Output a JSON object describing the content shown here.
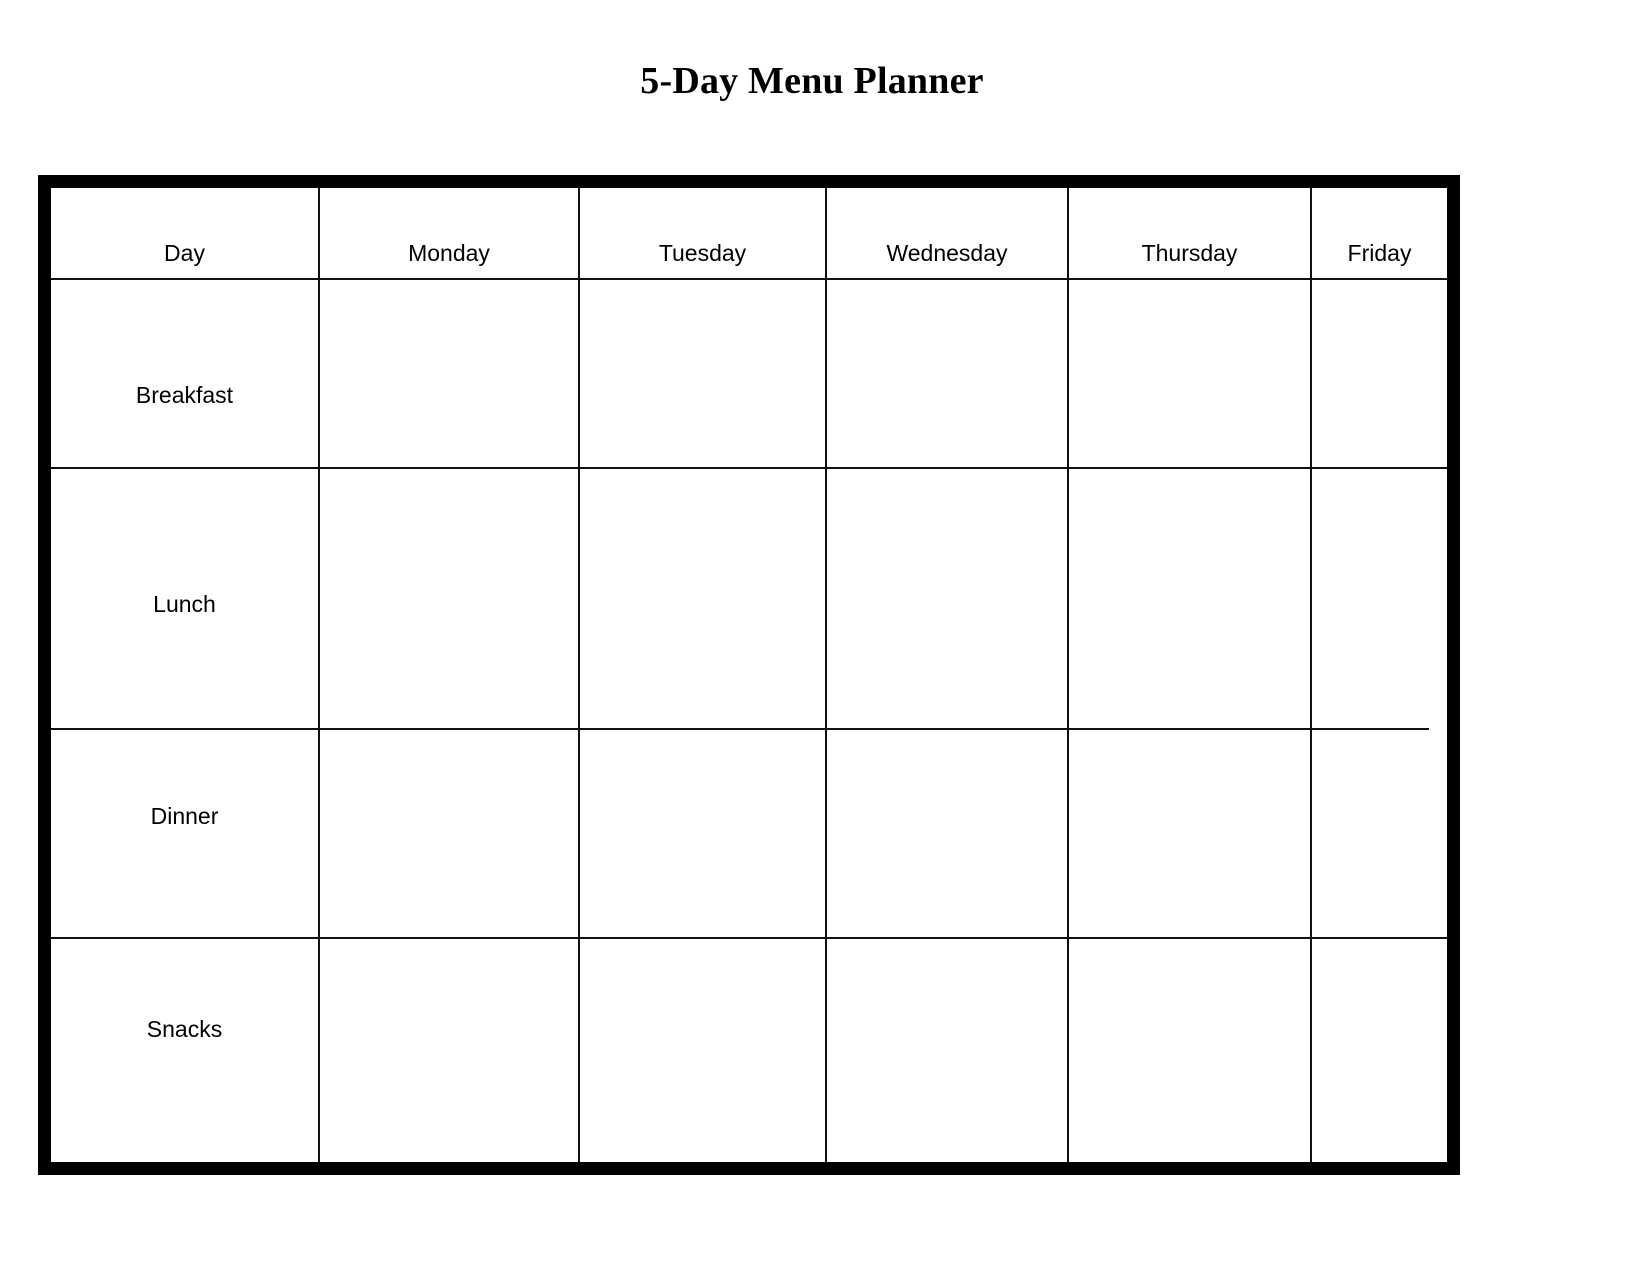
{
  "document": {
    "title": "5-Day Menu Planner",
    "background_color": "#ffffff",
    "ink_color": "#000000",
    "border_color": "#000000"
  },
  "table": {
    "corner_header": "Day",
    "day_columns": [
      {
        "label": "Monday"
      },
      {
        "label": "Tuesday"
      },
      {
        "label": "Wednesday"
      },
      {
        "label": "Thursday"
      },
      {
        "label": "Friday"
      }
    ],
    "meal_rows": [
      {
        "label": "Breakfast",
        "cells": [
          "",
          "",
          "",
          "",
          ""
        ]
      },
      {
        "label": "Lunch",
        "cells": [
          "",
          "",
          "",
          "",
          ""
        ]
      },
      {
        "label": "Dinner",
        "cells": [
          "",
          "",
          "",
          "",
          ""
        ]
      },
      {
        "label": "Snacks",
        "cells": [
          "",
          "",
          "",
          "",
          ""
        ]
      }
    ]
  }
}
